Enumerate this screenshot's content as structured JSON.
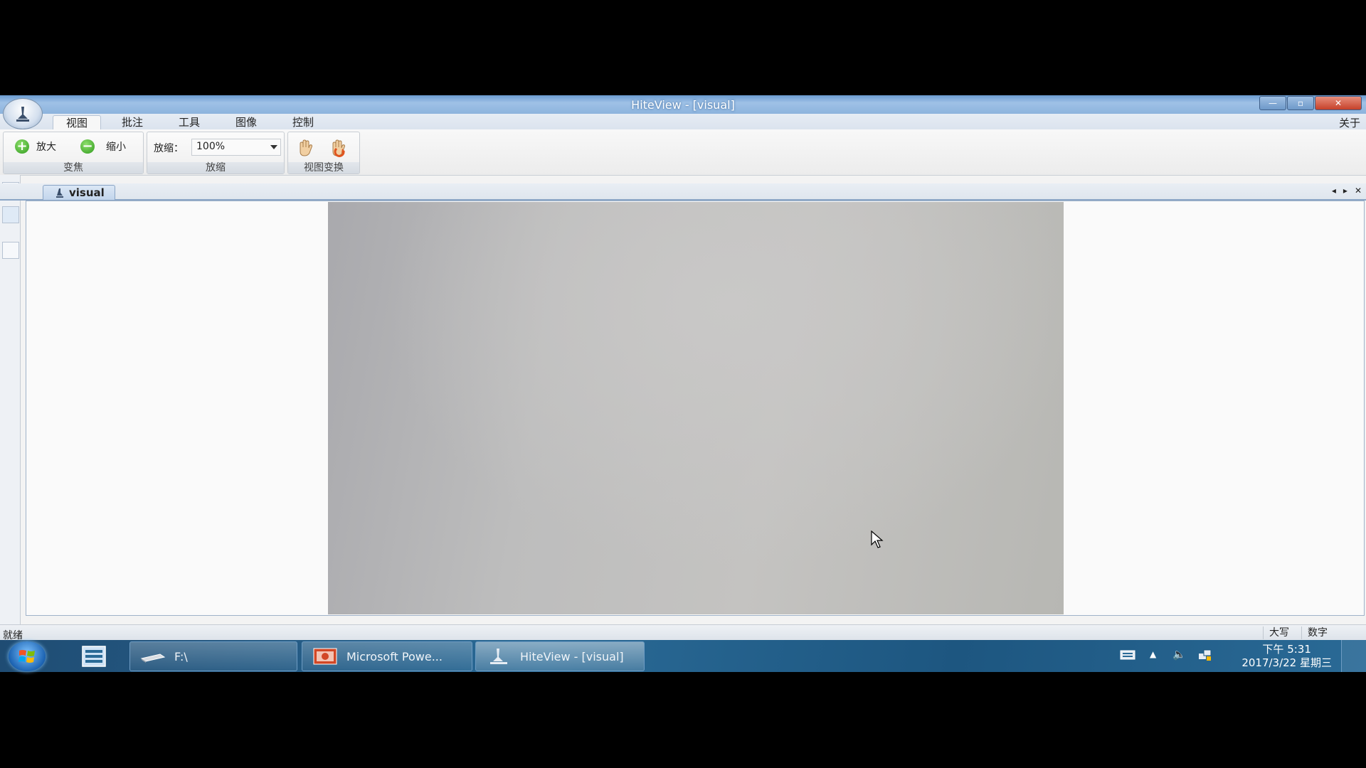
{
  "window": {
    "title": "HiteView - [visual]",
    "controls": {
      "minimize": "—",
      "maximize": "▫",
      "close": "✕"
    }
  },
  "menu": {
    "tabs": [
      "视图",
      "批注",
      "工具",
      "图像",
      "控制"
    ],
    "active": "视图",
    "about": "关于"
  },
  "ribbon": {
    "focus_group": {
      "label": "变焦",
      "zoom_in": "放大",
      "zoom_out": "缩小"
    },
    "scale_group": {
      "label": "放缩",
      "field_label": "放缩：",
      "value": "100%"
    },
    "view_group": {
      "label": "视图变换"
    }
  },
  "document": {
    "tab_label": "visual"
  },
  "statusbar": {
    "text": "就绪",
    "caps": "大写",
    "num": "数字"
  },
  "taskbar": {
    "items": [
      {
        "label": "F:\\",
        "icon": "drive-icon"
      },
      {
        "label": "Microsoft Powe...",
        "icon": "powerpoint-icon"
      },
      {
        "label": "HiteView - [visual]",
        "icon": "hiteview-icon"
      }
    ],
    "active_index": 2,
    "clock": {
      "time": "下午 5:31",
      "date": "2017/3/22 星期三"
    }
  }
}
